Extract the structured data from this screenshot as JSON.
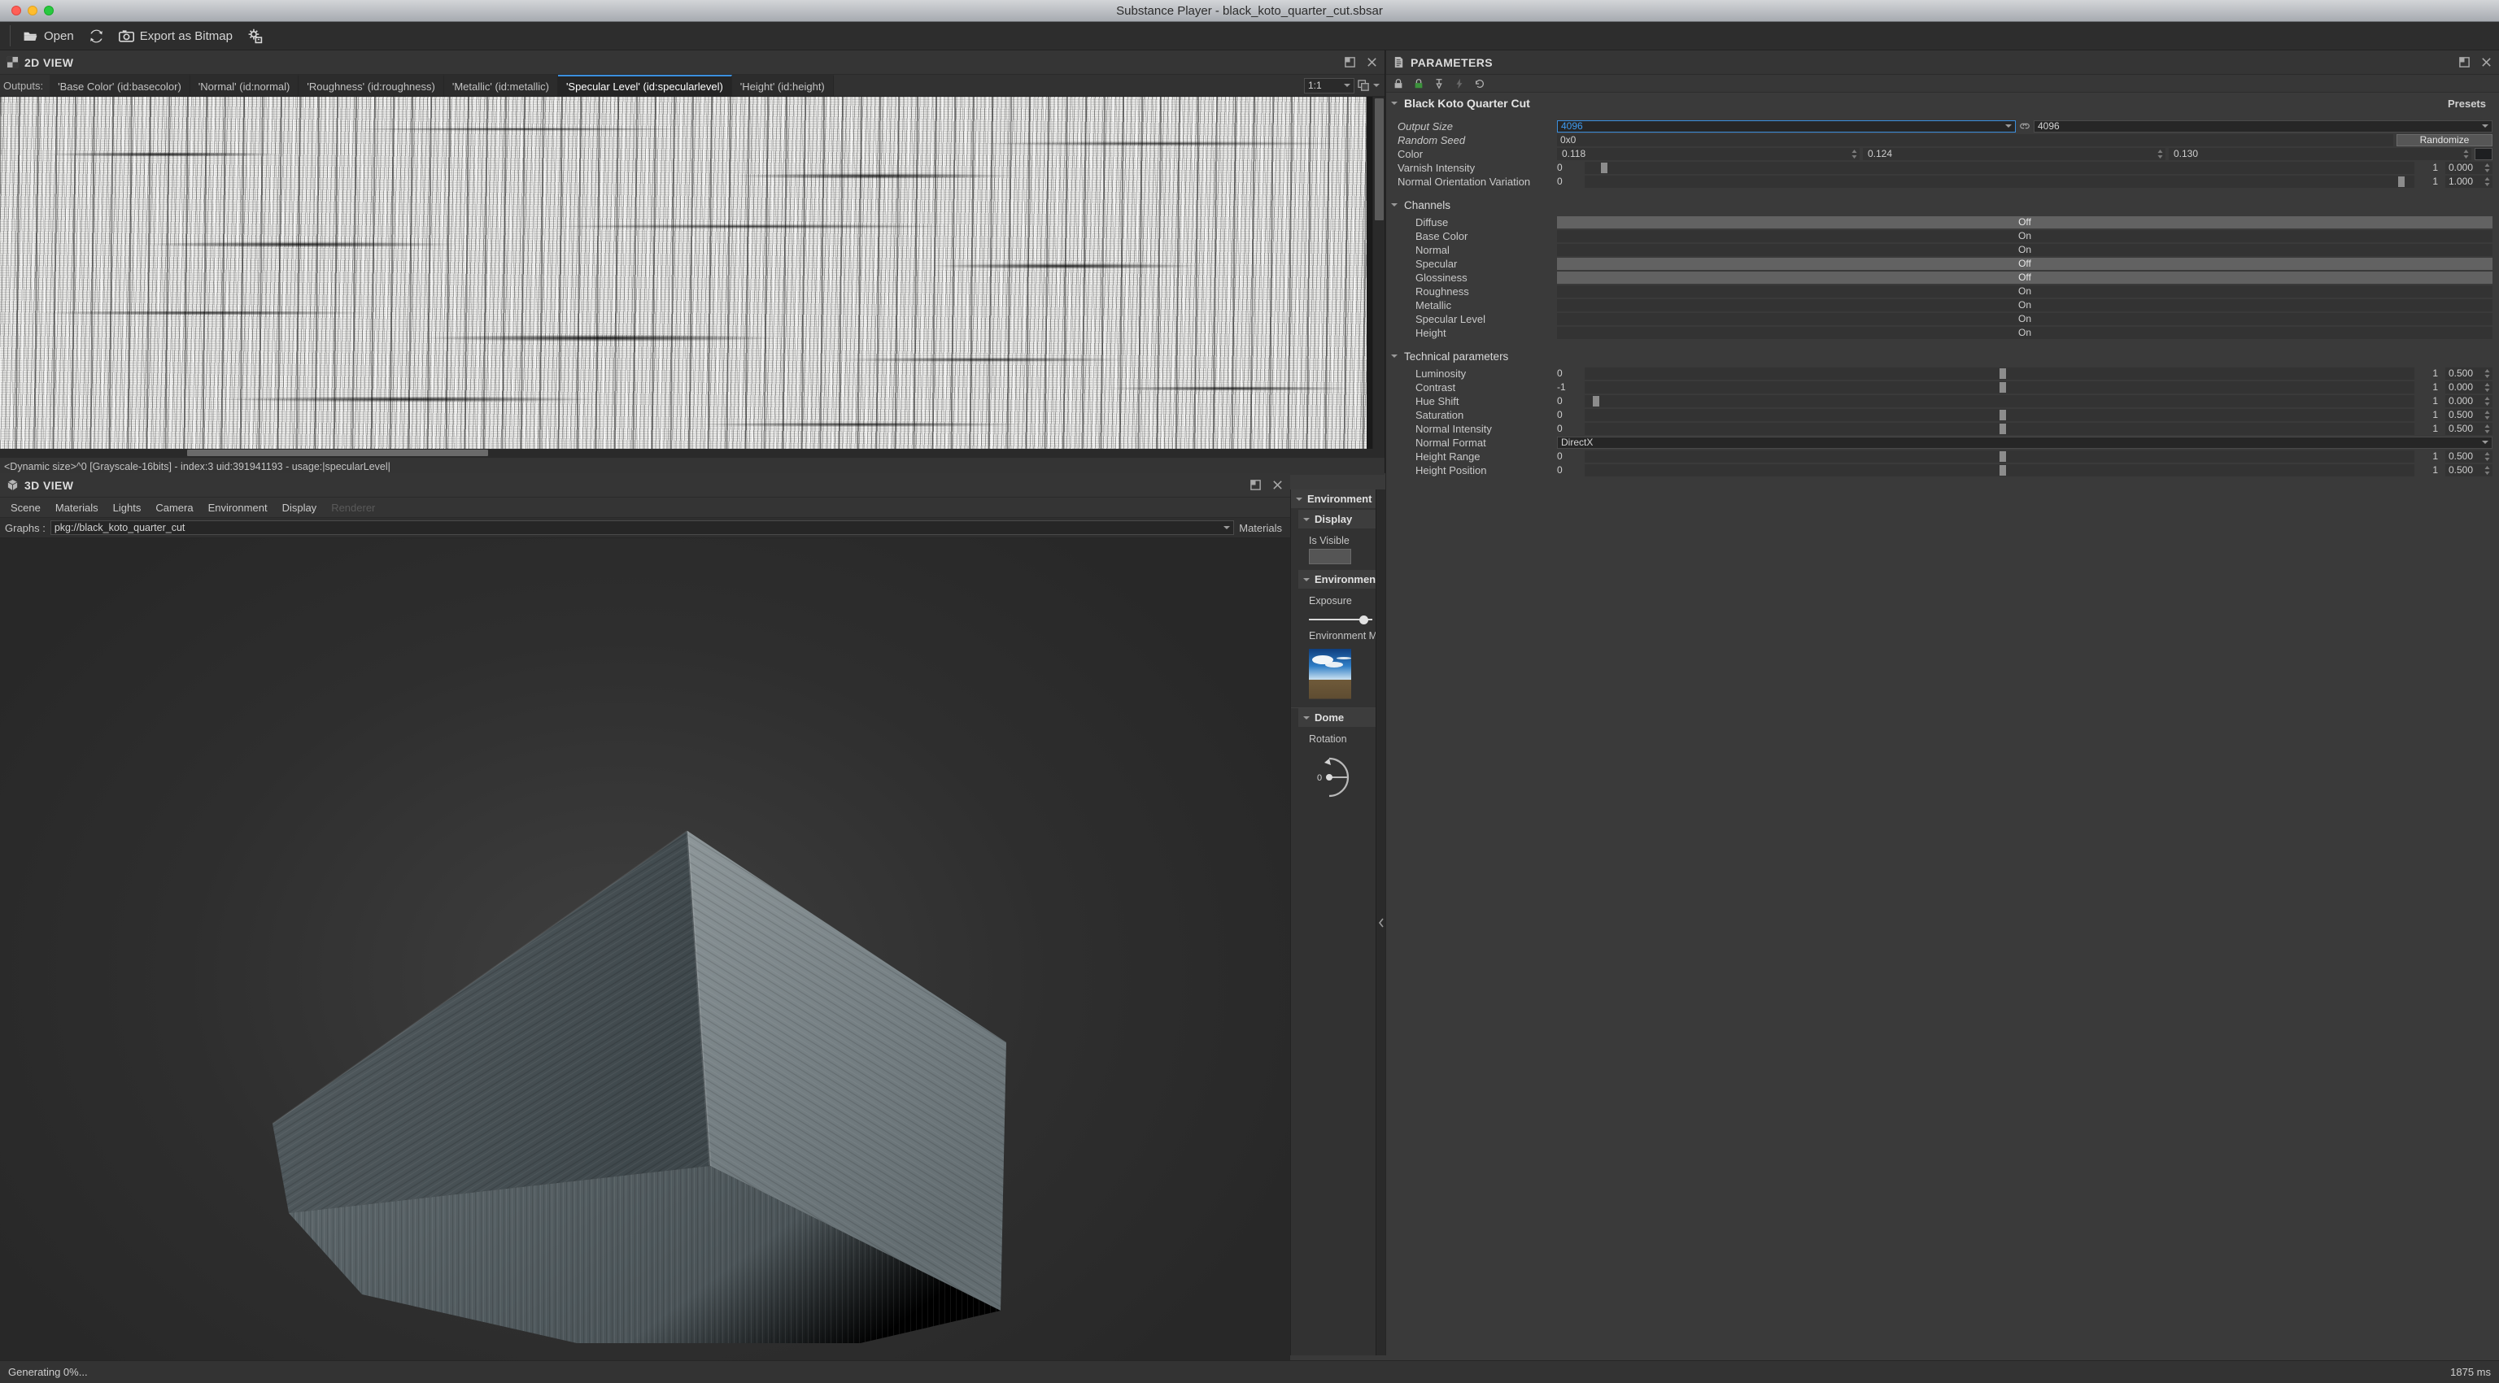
{
  "window": {
    "title": "Substance Player - black_koto_quarter_cut.sbsar"
  },
  "toolbar": {
    "open_label": "Open",
    "export_label": "Export as Bitmap"
  },
  "view2d": {
    "panel_title": "2D VIEW",
    "outputs_label": "Outputs:",
    "tabs": [
      {
        "label": "'Base Color' (id:basecolor)",
        "active": false
      },
      {
        "label": "'Normal' (id:normal)",
        "active": false
      },
      {
        "label": "'Roughness' (id:roughness)",
        "active": false
      },
      {
        "label": "'Metallic' (id:metallic)",
        "active": false
      },
      {
        "label": "'Specular Level' (id:specularlevel)",
        "active": true
      },
      {
        "label": "'Height' (id:height)",
        "active": false
      }
    ],
    "zoom_level": "1:1",
    "status": "<Dynamic size>^0 [Grayscale-16bits] - index:3 uid:391941193 - usage:|specularLevel|"
  },
  "view3d": {
    "panel_title": "3D VIEW",
    "menus": [
      {
        "label": "Scene",
        "disabled": false
      },
      {
        "label": "Materials",
        "disabled": false
      },
      {
        "label": "Lights",
        "disabled": false
      },
      {
        "label": "Camera",
        "disabled": false
      },
      {
        "label": "Environment",
        "disabled": false
      },
      {
        "label": "Display",
        "disabled": false
      },
      {
        "label": "Renderer",
        "disabled": true
      }
    ],
    "graphs_label": "Graphs :",
    "graphs_value": "pkg://black_koto_quarter_cut",
    "materials_label": "Materials"
  },
  "environment_panel": {
    "section_environment": "Environment",
    "section_display": "Display",
    "is_visible_label": "Is Visible",
    "section_environment_2": "Environment",
    "exposure_label": "Exposure",
    "environment_map_label": "Environment Map",
    "section_dome": "Dome",
    "rotation_label": "Rotation",
    "rotation_value": "0"
  },
  "parameters": {
    "panel_title": "PARAMETERS",
    "group_title": "Black Koto Quarter Cut",
    "presets_label": "Presets",
    "main": [
      {
        "label": "Output Size",
        "italic": true,
        "type": "combo-pair",
        "value_a": "4096",
        "value_b": "4096",
        "link_icon": "link-icon"
      },
      {
        "label": "Random Seed",
        "italic": true,
        "type": "text-randomize",
        "value": "0x0",
        "button": "Randomize"
      },
      {
        "label": "Color",
        "italic": false,
        "type": "color",
        "r": "0.118",
        "g": "0.124",
        "b": "0.130",
        "swatch": "#1e1f21"
      },
      {
        "label": "Varnish Intensity",
        "italic": false,
        "type": "slider",
        "min": "0",
        "max": "1",
        "value": "0.000",
        "fill": 0.02
      },
      {
        "label": "Normal Orientation Variation",
        "italic": false,
        "type": "slider",
        "min": "0",
        "max": "1",
        "value": "1.000",
        "fill": 0.99
      }
    ],
    "channels_title": "Channels",
    "channels": [
      {
        "label": "Diffuse",
        "state": "Off"
      },
      {
        "label": "Base Color",
        "state": "On"
      },
      {
        "label": "Normal",
        "state": "On"
      },
      {
        "label": "Specular",
        "state": "Off"
      },
      {
        "label": "Glossiness",
        "state": "Off"
      },
      {
        "label": "Roughness",
        "state": "On"
      },
      {
        "label": "Metallic",
        "state": "On"
      },
      {
        "label": "Specular Level",
        "state": "On"
      },
      {
        "label": "Height",
        "state": "On"
      }
    ],
    "technical_title": "Technical parameters",
    "technical": [
      {
        "label": "Luminosity",
        "type": "slider",
        "min": "0",
        "max": "1",
        "value": "0.500",
        "fill": 0.5
      },
      {
        "label": "Contrast",
        "type": "slider",
        "min": "-1",
        "max": "1",
        "value": "0.000",
        "fill": 0.5
      },
      {
        "label": "Hue Shift",
        "type": "slider",
        "min": "0",
        "max": "1",
        "value": "0.000",
        "fill": 0.02
      },
      {
        "label": "Saturation",
        "type": "slider",
        "min": "0",
        "max": "1",
        "value": "0.500",
        "fill": 0.5
      },
      {
        "label": "Normal Intensity",
        "type": "slider",
        "min": "0",
        "max": "1",
        "value": "0.500",
        "fill": 0.5
      },
      {
        "label": "Normal Format",
        "type": "combo",
        "value": "DirectX"
      },
      {
        "label": "Height Range",
        "type": "slider",
        "min": "0",
        "max": "1",
        "value": "0.500",
        "fill": 0.5
      },
      {
        "label": "Height Position",
        "type": "slider",
        "min": "0",
        "max": "1",
        "value": "0.500",
        "fill": 0.5
      }
    ]
  },
  "statusbar": {
    "message": "Generating 0%...",
    "render_time": "1875 ms"
  }
}
